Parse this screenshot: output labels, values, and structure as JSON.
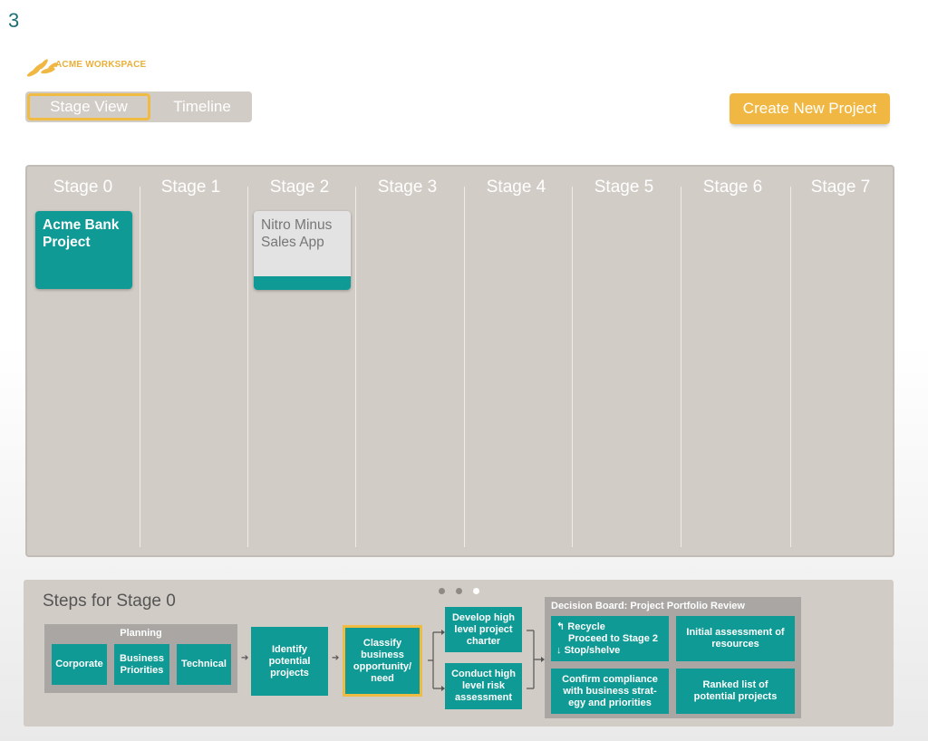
{
  "page_number": "3",
  "logo": {
    "text": "ACME WORKSPACE"
  },
  "view_toggle": {
    "stage_view": "Stage View",
    "timeline": "Timeline"
  },
  "create_button": "Create New Project",
  "stages": [
    "Stage 0",
    "Stage 1",
    "Stage 2",
    "Stage 3",
    "Stage 4",
    "Stage 5",
    "Stage 6",
    "Stage 7"
  ],
  "projects": [
    {
      "name": "Acme Bank Project",
      "stage": "Stage 0",
      "style": "teal"
    },
    {
      "name": "Nitro Minus Sales App",
      "stage": "Stage 2",
      "style": "grey"
    }
  ],
  "steps": {
    "title": "Steps for Stage 0",
    "pager": {
      "pages": 3,
      "current": 3
    },
    "planning": {
      "title": "Planning",
      "items": [
        "Corporate",
        "Business Priorities",
        "Technical"
      ]
    },
    "identify": "Identify potential projects",
    "classify": "Classify business opportunity/ need",
    "develop": "Develop high level project charter",
    "conduct": "Conduct high level risk assessment",
    "decision_board": {
      "title": "Decision Board: Project Portfolio Review",
      "outcomes": {
        "recycle": "Recycle",
        "proceed": "Proceed to Stage 2",
        "stop": "Stop/shelve"
      },
      "initial": "Initial assessment of resources",
      "confirm": "Confirm compliance with business strat- egy and priorities",
      "ranked": "Ranked list of potential projects"
    }
  },
  "colors": {
    "teal": "#0f9a95",
    "accent": "#f0b843",
    "panel": "#d2ccc6"
  }
}
